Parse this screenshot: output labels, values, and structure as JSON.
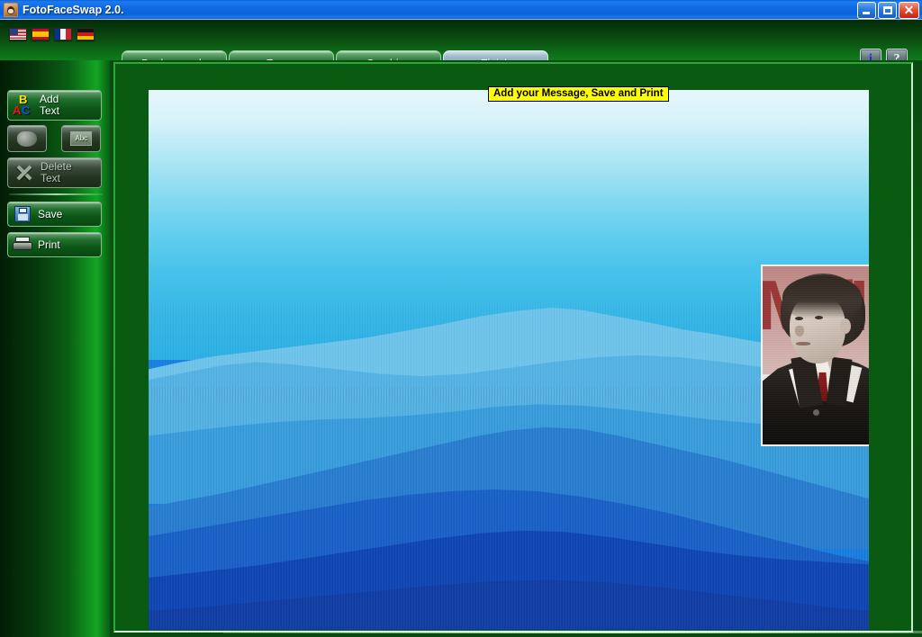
{
  "window": {
    "title": "FotoFaceSwap 2.0.",
    "icon": "app-face-icon",
    "controls": {
      "minimize": "_",
      "maximize": "❐",
      "close": "✕"
    }
  },
  "header": {
    "languages": [
      {
        "name": "flag-us-icon",
        "label": "English"
      },
      {
        "name": "flag-es-icon",
        "label": "Español"
      },
      {
        "name": "flag-fr-icon",
        "label": "Français"
      },
      {
        "name": "flag-de-icon",
        "label": "Deutsch"
      }
    ],
    "tabs": [
      {
        "label": "Backgrounds",
        "active": false
      },
      {
        "label": "Faces",
        "active": false
      },
      {
        "label": "Combine",
        "active": false
      },
      {
        "label": "Finish",
        "active": true
      }
    ],
    "buttons": [
      {
        "name": "info-button",
        "glyph": "i"
      },
      {
        "name": "help-button",
        "glyph": "?"
      }
    ]
  },
  "sidebar": {
    "items": [
      {
        "label": "Add\nText",
        "icon": "abc-letters-icon",
        "disabled": false
      },
      {
        "label": "",
        "icon": "shape-blob-icon",
        "disabled": true
      },
      {
        "label": "",
        "icon": "font-box-icon",
        "disabled": true
      },
      {
        "label": "Delete\nText",
        "icon": "x-mark-icon",
        "disabled": true
      },
      {
        "label": "Save",
        "icon": "floppy-disk-icon",
        "disabled": false
      },
      {
        "label": "Print",
        "icon": "printer-icon",
        "disabled": false
      }
    ],
    "icon_text": {
      "abc_b": "B",
      "abc_a": "A",
      "abc_c": "C",
      "font_box": "Abc"
    }
  },
  "main": {
    "tooltip": "Add your Message, Save and Print",
    "canvas": {
      "name": "photo-composition-canvas",
      "background_image": "blue-layered-mountains",
      "pasted_photo": {
        "name": "pasted-face-photo",
        "description": "black and white portrait of a man in dark suit and tie",
        "magazine_letters": [
          "M",
          "M",
          "I"
        ]
      }
    }
  },
  "colors": {
    "titlebar_blue": "#0f6ae2",
    "panel_green": "#0b5a12",
    "sidebar_dark_green": "#021d05",
    "tooltip_yellow": "#ffff00",
    "active_tab": "#7fa3ba",
    "sky_top": "#e6f7fb",
    "forest_deep": "#123fa6"
  }
}
